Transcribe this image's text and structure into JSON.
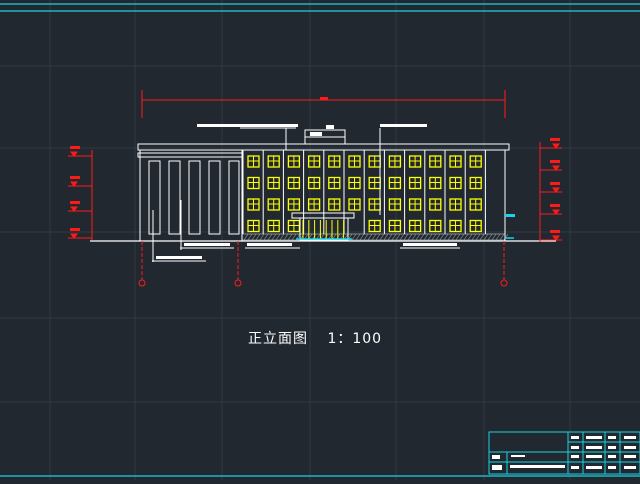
{
  "drawing": {
    "caption": "正立面图",
    "scale": "1：100"
  },
  "colors": {
    "background": "#212830",
    "frame": "#19d4e4",
    "building": "#ffffff",
    "windows": "#ffff00",
    "dimensions": "#ff1a1a",
    "grid": "#2e3a44",
    "hatch": "#9aa0a6"
  },
  "building": {
    "floors": 4,
    "window_columns": 12
  }
}
